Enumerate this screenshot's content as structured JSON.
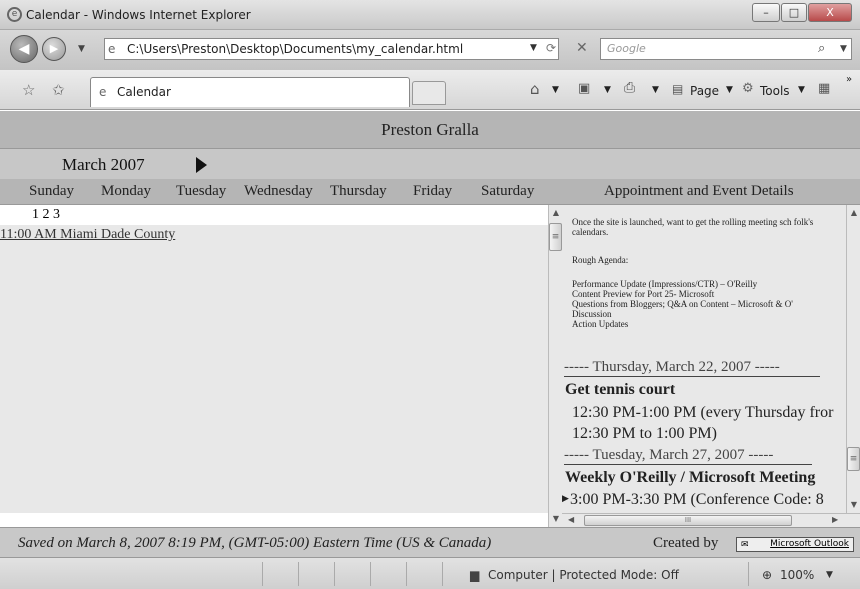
{
  "window": {
    "title": "Calendar - Windows Internet Explorer",
    "minimize": "–",
    "maximize": "□",
    "close": "X"
  },
  "address_bar": {
    "url": "C:\\Users\\Preston\\Desktop\\Documents\\my_calendar.html",
    "search_placeholder": "Google"
  },
  "tab": {
    "label": "Calendar"
  },
  "commands": {
    "page": "Page",
    "tools": "Tools"
  },
  "calendar": {
    "owner": "Preston Gralla",
    "month": "March 2007",
    "days": [
      "Sunday",
      "Monday",
      "Tuesday",
      "Wednesday",
      "Thursday",
      "Friday",
      "Saturday"
    ],
    "details_header": "Appointment and Event Details",
    "dates": "1 2 3",
    "events": [
      "11:00 AM Miami Dade County"
    ]
  },
  "details": {
    "intro": "Once the site is launched, want to get the rolling meeting sch folk's calendars.",
    "agenda_title": "Rough Agenda:",
    "agenda_items": [
      "Performance Update (Impressions/CTR) – O'Reilly",
      "Content Preview for Port 25-  Microsoft",
      "Questions from Bloggers; Q&A on Content – Microsoft & O'",
      "Discussion",
      "Action Updates"
    ],
    "sep1": "----- Thursday, March 22, 2007 -----",
    "ev1_title": "Get tennis court",
    "ev1_line1": "12:30 PM-1:00 PM (every Thursday fror",
    "ev1_line2": "12:30 PM to 1:00 PM)",
    "sep2": "----- Tuesday, March 27, 2007 -----",
    "ev2_title": "Weekly O'Reilly / Microsoft Meeting",
    "ev2_line1": "3:00 PM-3:30 PM (Conference Code: 8"
  },
  "footer": {
    "saved": "Saved on March 8, 2007 8:19 PM, (GMT-05:00) Eastern Time (US & Canada)",
    "created_by": "Created by",
    "outlook": "Microsoft Outlook"
  },
  "status": {
    "zone": "Computer | Protected Mode: Off",
    "zoom": "100%"
  }
}
